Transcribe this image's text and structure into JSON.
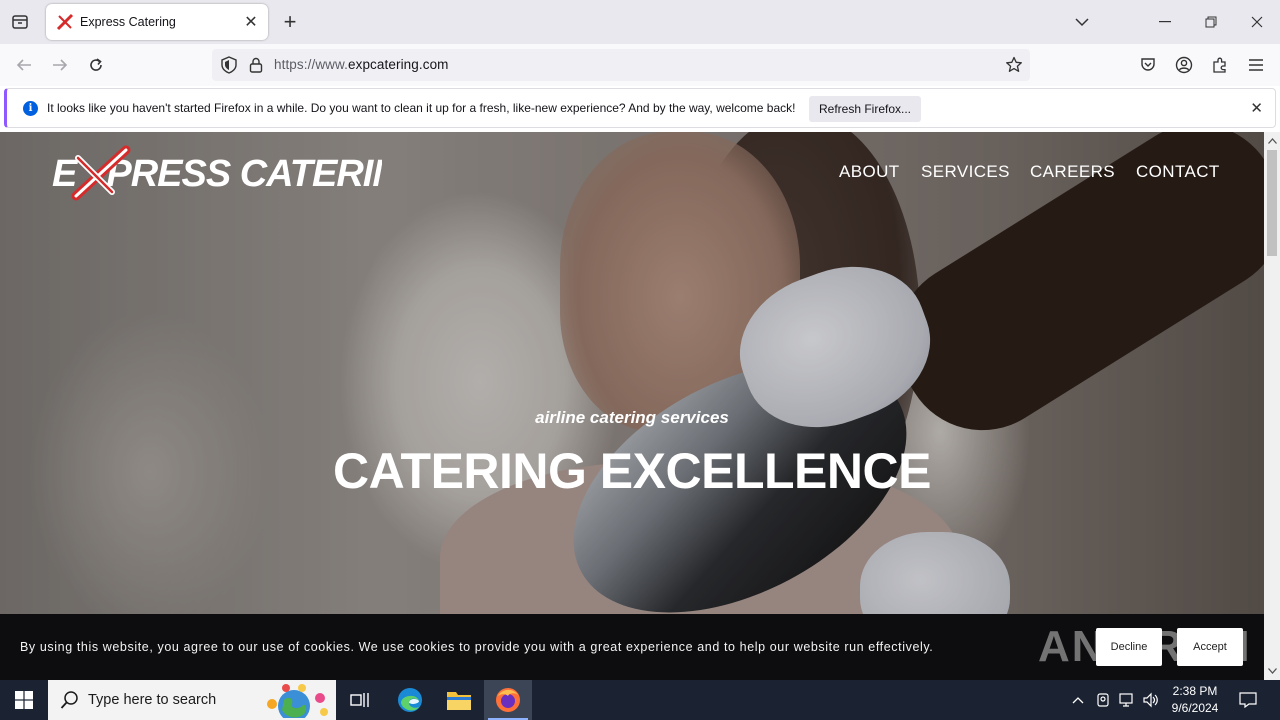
{
  "browser": {
    "tab": {
      "title": "Express Catering"
    },
    "url": {
      "prefix": "https://www.",
      "domain": "expcatering.com"
    },
    "notification": {
      "message": "It looks like you haven't started Firefox in a while. Do you want to clean it up for a fresh, like-new experience? And by the way, welcome back!",
      "button": "Refresh Firefox..."
    }
  },
  "site": {
    "logo": "EXPRESS CATERING",
    "nav": [
      "ABOUT",
      "SERVICES",
      "CAREERS",
      "CONTACT"
    ],
    "hero": {
      "tagline": "airline catering services",
      "headline": "CATERING EXCELLENCE"
    },
    "cookie": {
      "text": "By using this website, you agree to our use of cookies. We use cookies to provide you with a great experience and to help our website run effectively.",
      "decline": "Decline",
      "accept": "Accept"
    },
    "watermark": "ANY RUN"
  },
  "taskbar": {
    "search_placeholder": "Type here to search",
    "time": "2:38 PM",
    "date": "9/6/2024"
  },
  "colors": {
    "logo_accent": "#d52b2b",
    "firefox_accent": "#9059ff",
    "info_blue": "#0060df"
  }
}
